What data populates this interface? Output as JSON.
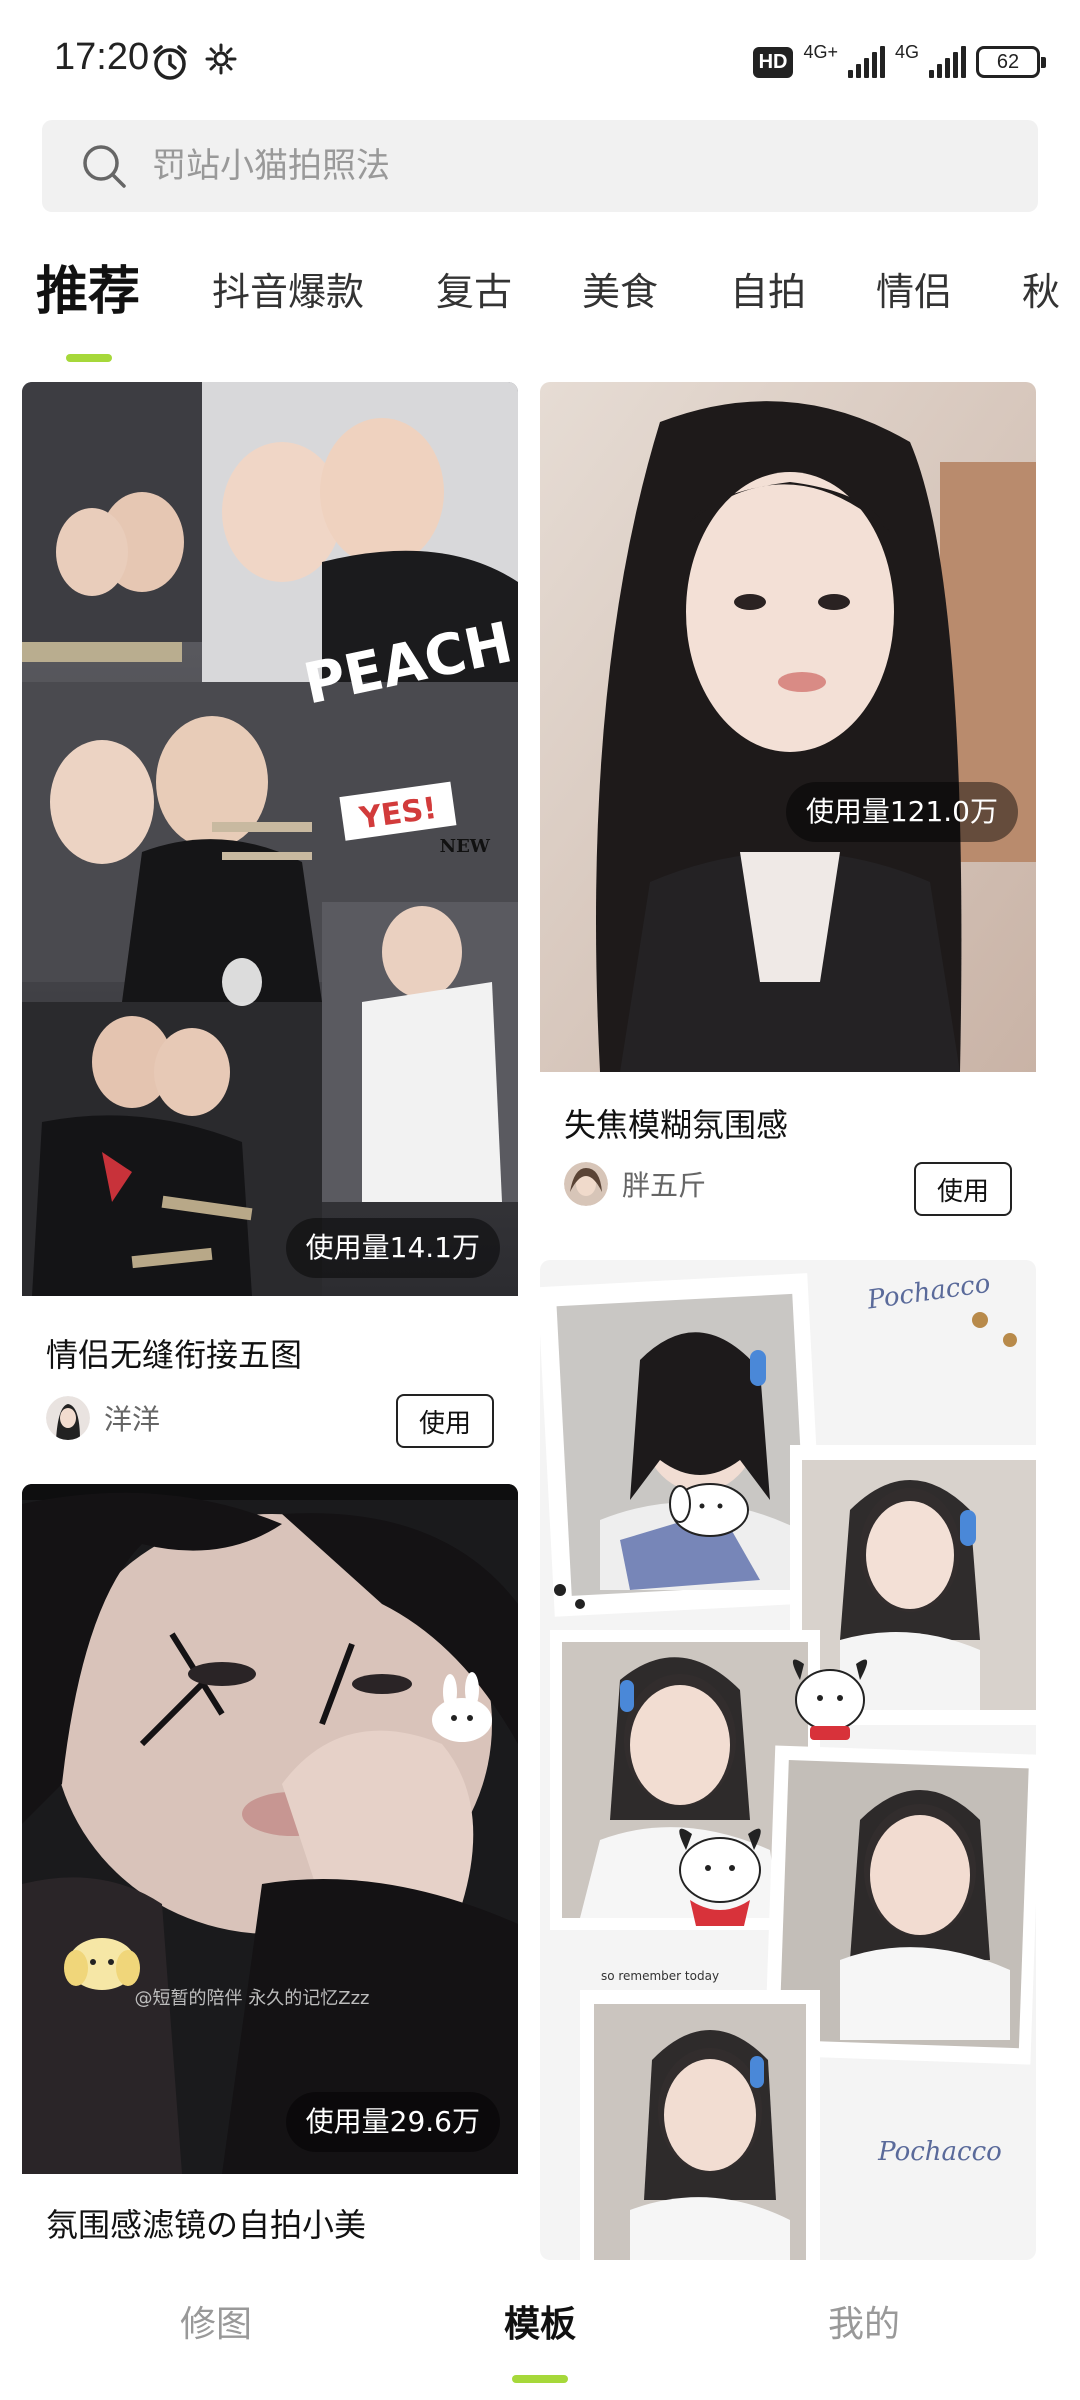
{
  "status_bar": {
    "time": "17:20",
    "hd_badge": "HD",
    "net1": "4G+",
    "net2": "4G",
    "battery": "62",
    "icons": [
      "alarm-icon",
      "gear-icon",
      "signal-icon",
      "battery-icon"
    ]
  },
  "search": {
    "placeholder": "罚站小猫拍照法"
  },
  "tabs": [
    {
      "label": "推荐",
      "active": true
    },
    {
      "label": "抖音爆款",
      "active": false
    },
    {
      "label": "复古",
      "active": false
    },
    {
      "label": "美食",
      "active": false
    },
    {
      "label": "自拍",
      "active": false
    },
    {
      "label": "情侣",
      "active": false
    },
    {
      "label": "秋",
      "active": false
    }
  ],
  "cards": [
    {
      "usage": "使用量14.1万",
      "title": "情侣无缝衔接五图",
      "author": "洋洋",
      "button": "使用"
    },
    {
      "usage": "使用量121.0万",
      "title": "失焦模糊氛围感",
      "author": "胖五斤",
      "button": "使用"
    },
    {
      "usage": "使用量29.6万",
      "overlay_text": "@短暂的陪伴 永久的记忆Zzz",
      "title": "氛围感滤镜の自拍小美"
    },
    {
      "sticker_text": "Pochacco",
      "sticker_text_2": "so remember today"
    }
  ],
  "card1_stickers": {
    "yes": "YES!",
    "new": "NEW",
    "shirt": "PEACH"
  },
  "bottom_nav": [
    {
      "label": "修图",
      "active": false
    },
    {
      "label": "模板",
      "active": true
    },
    {
      "label": "我的",
      "active": false
    }
  ],
  "colors": {
    "accent": "#a6d83a",
    "search_bg": "#f1f1f1",
    "usage_bg": "rgba(0,0,0,0.45)"
  }
}
